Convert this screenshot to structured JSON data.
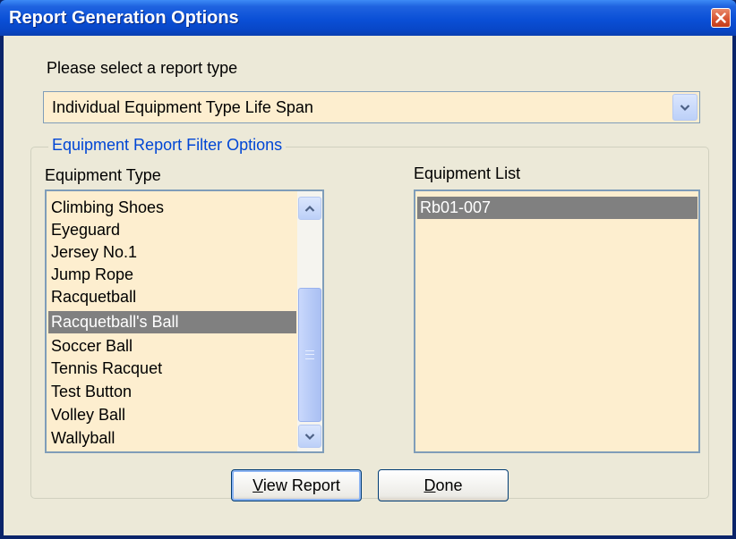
{
  "window": {
    "title": "Report Generation Options",
    "close_icon": "close-icon"
  },
  "report_type": {
    "label": "Please select a report type",
    "selected": "Individual Equipment Type Life Span"
  },
  "filter_group": {
    "legend": "Equipment Report Filter Options",
    "equipment_type": {
      "label": "Equipment Type",
      "items": [
        "Climbing Shoes",
        "Eyeguard",
        "Jersey No.1",
        "Jump Rope",
        "Racquetball",
        "Racquetball's Ball",
        "Soccer Ball",
        "Tennis Racquet",
        "Test Button",
        "Volley Ball",
        "Wallyball"
      ],
      "selected": "Racquetball's Ball"
    },
    "equipment_list": {
      "label": "Equipment List",
      "items": [
        "Rb01-007"
      ],
      "selected": "Rb01-007"
    }
  },
  "buttons": {
    "view_report": {
      "mnemonic": "V",
      "rest": "iew Report"
    },
    "done": {
      "mnemonic": "D",
      "rest": "one"
    }
  },
  "colors": {
    "title_bar": "#0a4fd6",
    "list_background": "#fdeecf",
    "selection": "#808080",
    "group_legend": "#0046d5"
  }
}
